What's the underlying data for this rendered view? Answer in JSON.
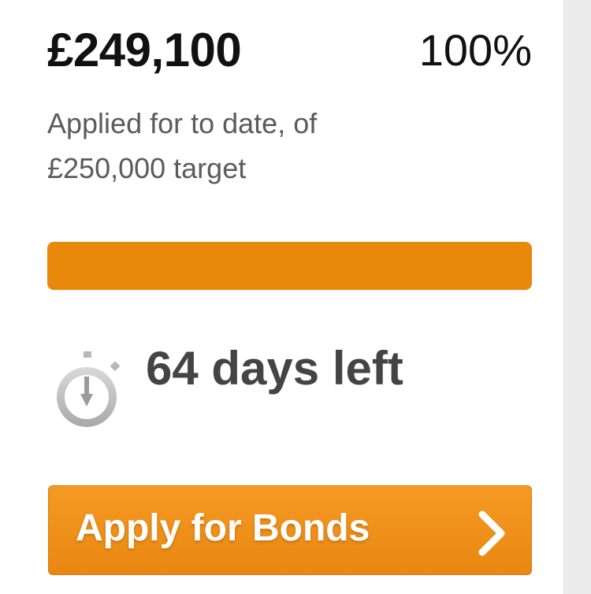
{
  "funding": {
    "amount_raised": "£249,100",
    "percent_label": "100%",
    "progress_fraction": 1.0,
    "subtitle": "Applied for to date, of £250,000 target"
  },
  "countdown": {
    "icon": "stopwatch-icon",
    "label": "64 days left"
  },
  "cta": {
    "label": "Apply for Bonds",
    "icon": "chevron-right-icon"
  },
  "colors": {
    "accent_orange": "#e9890b",
    "button_orange": "#f0931d",
    "heading_text": "#111111",
    "muted_text": "#5b5b5b"
  }
}
